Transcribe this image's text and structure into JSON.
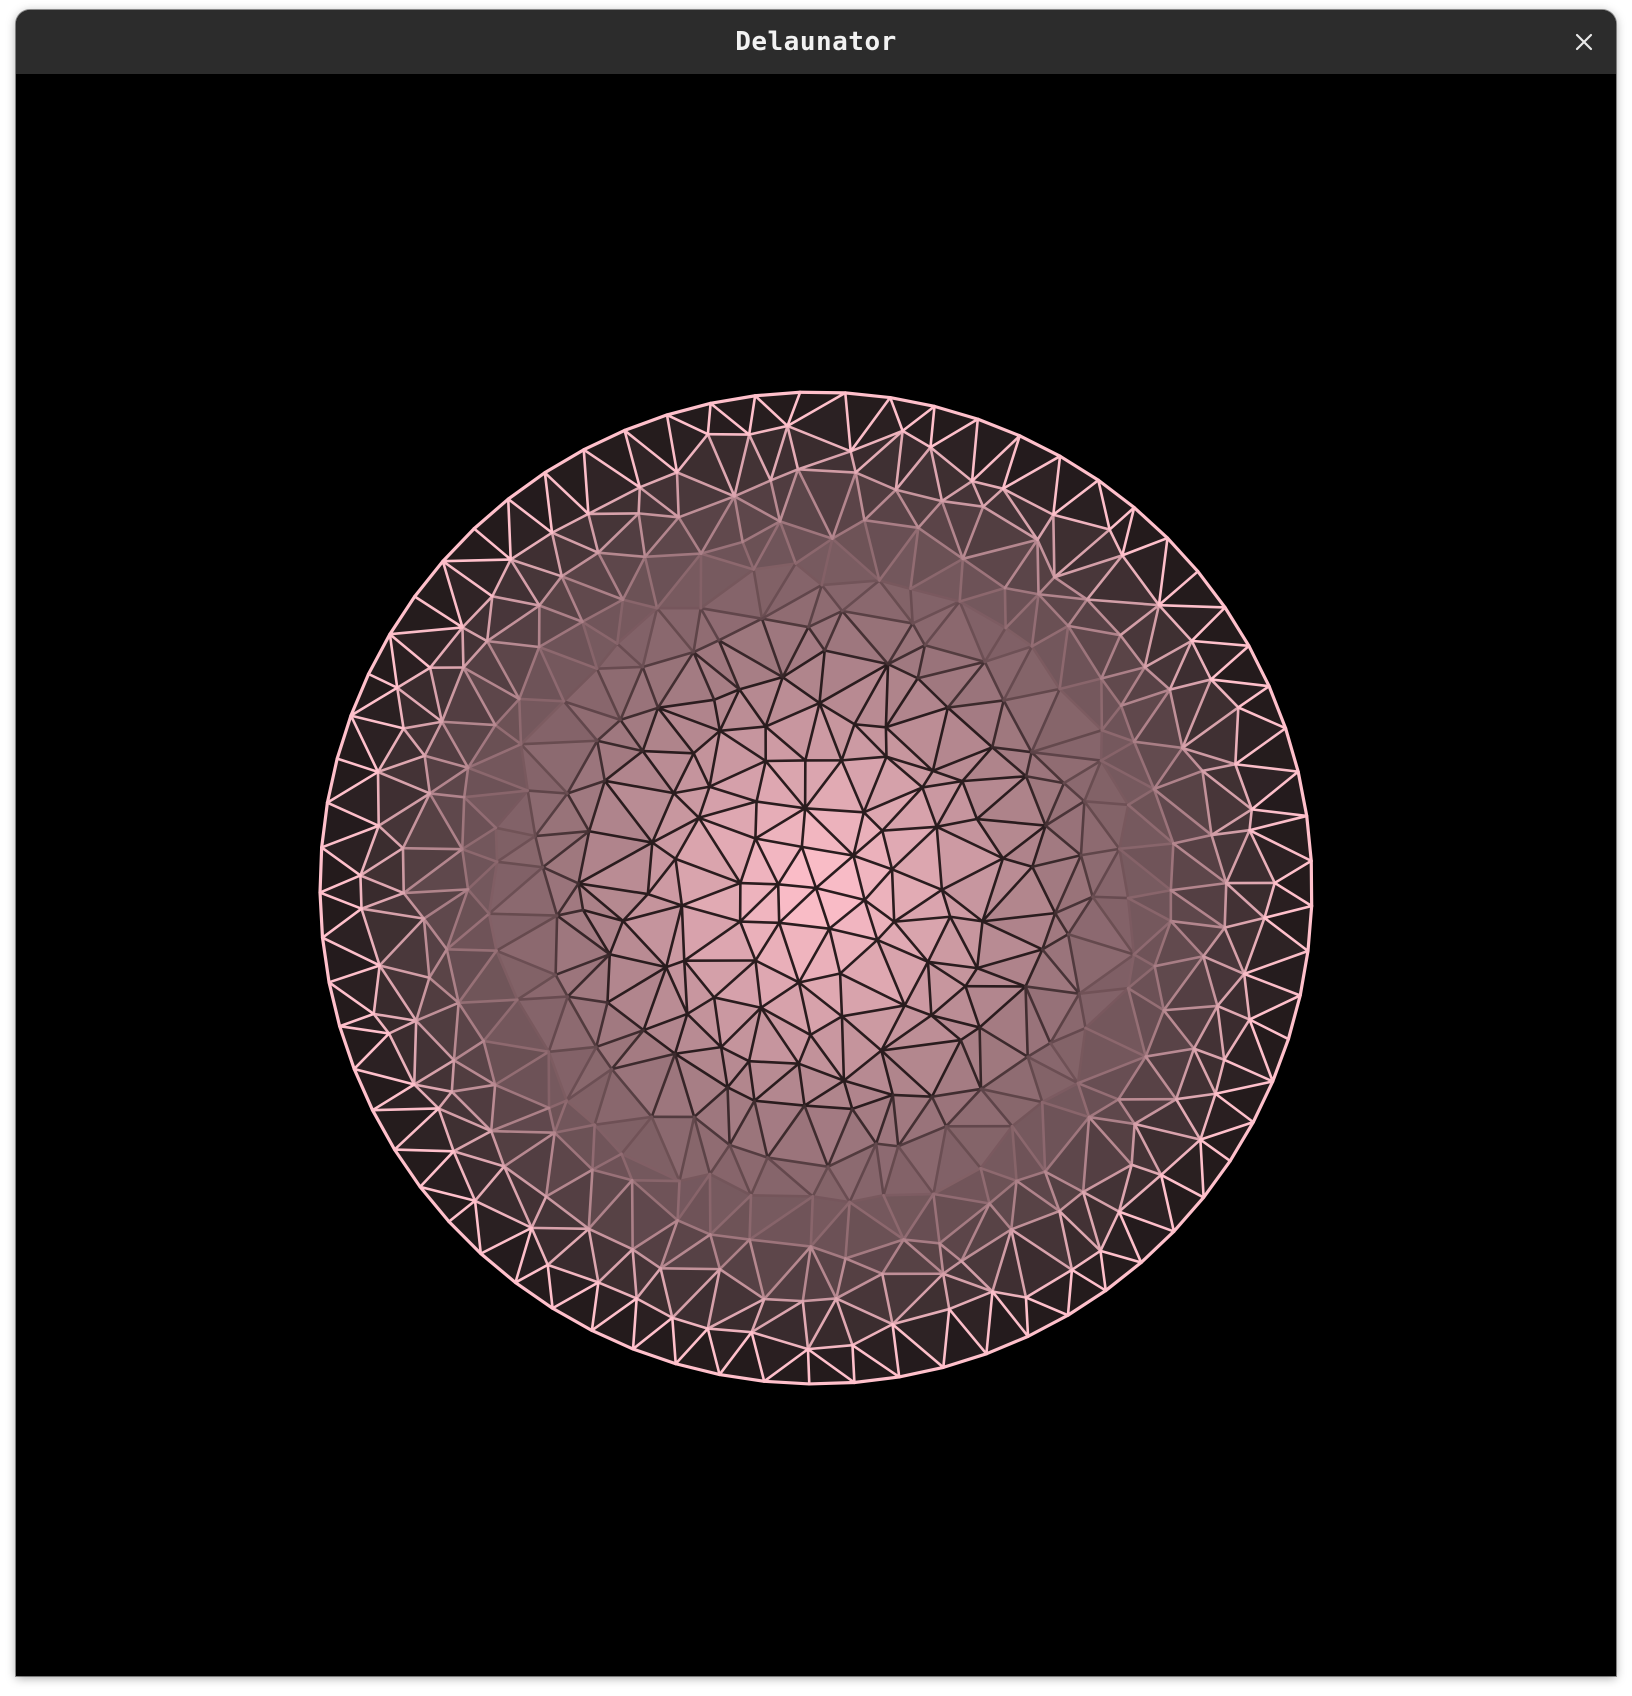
{
  "window": {
    "title": "Delaunator",
    "close_icon": "close-icon"
  },
  "canvas": {
    "background": "#000000",
    "center_color": "#ffc0cb",
    "edge_color": "#2a1c1e",
    "hull_stroke_color": "#ffc0cb"
  }
}
